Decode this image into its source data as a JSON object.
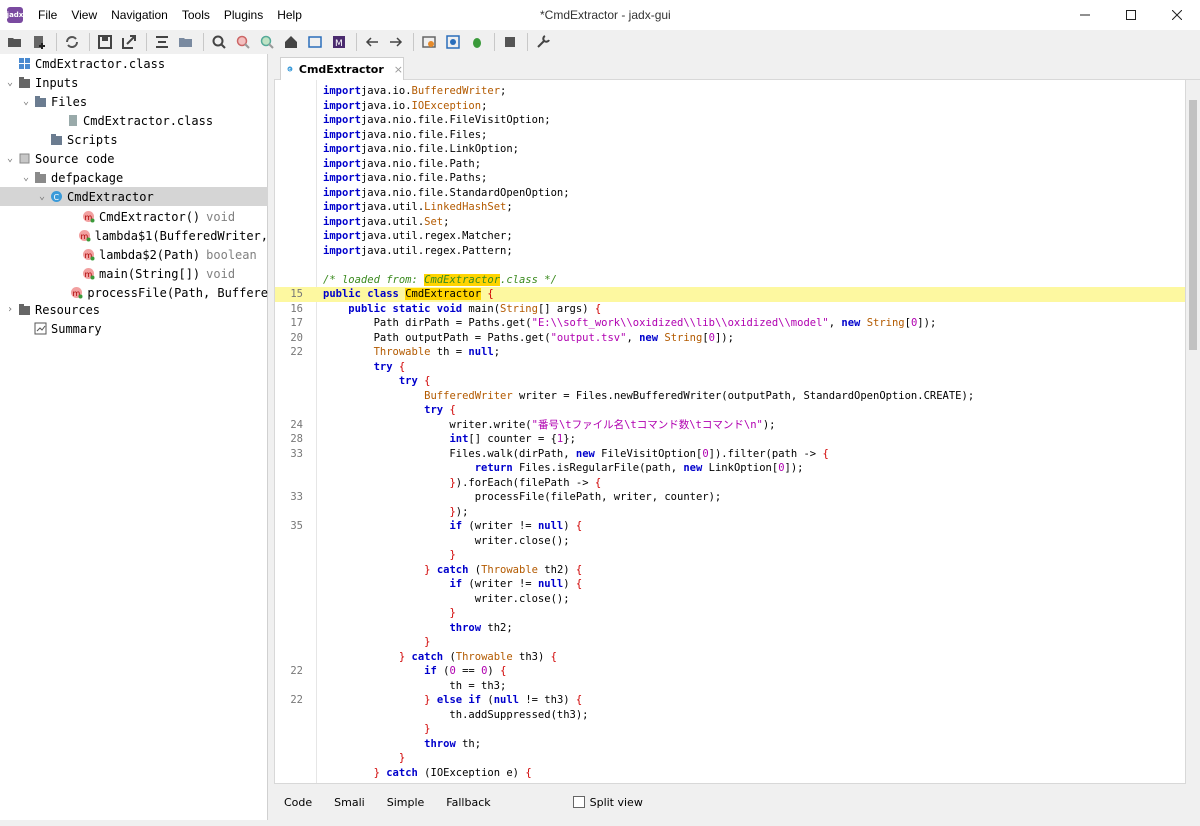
{
  "window": {
    "app_icon": "jadx",
    "title": "*CmdExtractor - jadx-gui",
    "controls": [
      "minimize-icon",
      "maximize-icon",
      "close-icon"
    ]
  },
  "menu": [
    "File",
    "View",
    "Navigation",
    "Tools",
    "Plugins",
    "Help"
  ],
  "toolbar": {
    "icons": [
      "open-folder-icon",
      "add-files-icon",
      "sync-icon",
      "save-icon",
      "export-icon",
      "sync-tree-icon",
      "flatten-packages-icon",
      "search-icon",
      "find-class-icon",
      "find-usage-icon",
      "home-icon",
      "logcat-icon",
      "smali-icon",
      "back-icon",
      "forward-icon",
      "deobfuscation-icon",
      "decompile-all-icon",
      "debug-icon",
      "log-icon",
      "preferences-icon"
    ]
  },
  "tree": {
    "items": [
      {
        "label": "CmdExtractor.class",
        "suffix": "",
        "icon": "jar-icon",
        "toggle": ""
      },
      {
        "label": "Inputs",
        "suffix": "",
        "icon": "inputs-folder-icon",
        "toggle": "v"
      },
      {
        "label": "Files",
        "suffix": "",
        "icon": "folder-icon",
        "toggle": "v"
      },
      {
        "label": "CmdExtractor.class",
        "suffix": "",
        "icon": "file-icon",
        "toggle": ""
      },
      {
        "label": "Scripts",
        "suffix": "",
        "icon": "folder-icon",
        "toggle": ""
      },
      {
        "label": "Source code",
        "suffix": "",
        "icon": "package-icon",
        "toggle": "v"
      },
      {
        "label": "defpackage",
        "suffix": "",
        "icon": "package-folder-icon",
        "toggle": "v"
      },
      {
        "label": "CmdExtractor",
        "suffix": "",
        "icon": "class-icon",
        "toggle": "v"
      },
      {
        "label": "CmdExtractor()",
        "suffix": "void",
        "icon": "method-icon",
        "toggle": ""
      },
      {
        "label": "lambda$1(BufferedWriter,",
        "suffix": "",
        "icon": "method-icon",
        "toggle": ""
      },
      {
        "label": "lambda$2(Path)",
        "suffix": "boolean",
        "icon": "method-icon",
        "toggle": ""
      },
      {
        "label": "main(String[])",
        "suffix": "void",
        "icon": "method-icon",
        "toggle": ""
      },
      {
        "label": "processFile(Path, Buffere",
        "suffix": "",
        "icon": "method-icon",
        "toggle": ""
      },
      {
        "label": "Resources",
        "suffix": "",
        "icon": "resources-icon",
        "toggle": ">"
      },
      {
        "label": "Summary",
        "suffix": "",
        "icon": "summary-icon",
        "toggle": ""
      }
    ]
  },
  "editor": {
    "tab_label": "CmdExtractor",
    "tab_close": "×",
    "lines": [
      {
        "n": "",
        "t": [
          [
            "kw",
            "import"
          ],
          [
            "",
            "java.io."
          ],
          [
            "ty",
            "BufferedWriter"
          ],
          [
            "",
            ";"
          ]
        ]
      },
      {
        "n": "",
        "t": [
          [
            "kw",
            "import"
          ],
          [
            "",
            "java.io."
          ],
          [
            "ty",
            "IOException"
          ],
          [
            "",
            ";"
          ]
        ]
      },
      {
        "n": "",
        "t": [
          [
            "kw",
            "import"
          ],
          [
            "",
            "java.nio.file.FileVisitOption;"
          ]
        ]
      },
      {
        "n": "",
        "t": [
          [
            "kw",
            "import"
          ],
          [
            "",
            "java.nio.file.Files;"
          ]
        ]
      },
      {
        "n": "",
        "t": [
          [
            "kw",
            "import"
          ],
          [
            "",
            "java.nio.file.LinkOption;"
          ]
        ]
      },
      {
        "n": "",
        "t": [
          [
            "kw",
            "import"
          ],
          [
            "",
            "java.nio.file.Path;"
          ]
        ]
      },
      {
        "n": "",
        "t": [
          [
            "kw",
            "import"
          ],
          [
            "",
            "java.nio.file.Paths;"
          ]
        ]
      },
      {
        "n": "",
        "t": [
          [
            "kw",
            "import"
          ],
          [
            "",
            "java.nio.file.StandardOpenOption;"
          ]
        ]
      },
      {
        "n": "",
        "t": [
          [
            "kw",
            "import"
          ],
          [
            "",
            "java.util."
          ],
          [
            "ty",
            "LinkedHashSet"
          ],
          [
            "",
            ";"
          ]
        ]
      },
      {
        "n": "",
        "t": [
          [
            "kw",
            "import"
          ],
          [
            "",
            "java.util."
          ],
          [
            "ty",
            "Set"
          ],
          [
            "",
            ";"
          ]
        ]
      },
      {
        "n": "",
        "t": [
          [
            "kw",
            "import"
          ],
          [
            "",
            "java.util.regex.Matcher;"
          ]
        ]
      },
      {
        "n": "",
        "t": [
          [
            "kw",
            "import"
          ],
          [
            "",
            "java.util.regex.Pattern;"
          ]
        ]
      },
      {
        "n": "",
        "t": []
      },
      {
        "n": "",
        "t": [
          [
            "cm",
            "/* loaded from: "
          ],
          [
            "cm-hl",
            "CmdExtractor"
          ],
          [
            "cm",
            ".class */"
          ]
        ]
      },
      {
        "n": "15",
        "hl": true,
        "t": [
          [
            "kw",
            "public class "
          ],
          [
            "cls-hl",
            "CmdExtractor"
          ],
          [
            "br",
            " {"
          ]
        ]
      },
      {
        "n": "16",
        "t": [
          [
            "",
            "    "
          ],
          [
            "kw",
            "public static void "
          ],
          [
            "",
            "main("
          ],
          [
            "ty",
            "String"
          ],
          [
            "",
            "[] args) "
          ],
          [
            "br",
            "{"
          ]
        ]
      },
      {
        "n": "17",
        "t": [
          [
            "",
            "        Path dirPath = Paths.get("
          ],
          [
            "str",
            "\"E:\\\\soft_work\\\\oxidized\\\\lib\\\\oxidized\\\\model\""
          ],
          [
            "",
            ", "
          ],
          [
            "kw",
            "new "
          ],
          [
            "ty",
            "String"
          ],
          [
            "",
            "["
          ],
          [
            "str",
            "0"
          ],
          [
            "",
            "]);"
          ]
        ]
      },
      {
        "n": "20",
        "t": [
          [
            "",
            "        Path outputPath = Paths.get("
          ],
          [
            "str",
            "\"output.tsv\""
          ],
          [
            "",
            ", "
          ],
          [
            "kw",
            "new "
          ],
          [
            "ty",
            "String"
          ],
          [
            "",
            "["
          ],
          [
            "str",
            "0"
          ],
          [
            "",
            "]);"
          ]
        ]
      },
      {
        "n": "22",
        "t": [
          [
            "",
            "        "
          ],
          [
            "ty",
            "Throwable"
          ],
          [
            "",
            " th = "
          ],
          [
            "kw",
            "null"
          ],
          [
            "",
            ";"
          ]
        ]
      },
      {
        "n": "",
        "t": [
          [
            "",
            "        "
          ],
          [
            "kw",
            "try "
          ],
          [
            "br",
            "{"
          ]
        ]
      },
      {
        "n": "",
        "t": [
          [
            "",
            "            "
          ],
          [
            "kw",
            "try "
          ],
          [
            "br",
            "{"
          ]
        ]
      },
      {
        "n": "",
        "t": [
          [
            "",
            "                "
          ],
          [
            "ty",
            "BufferedWriter"
          ],
          [
            "",
            " writer = Files.newBufferedWriter(outputPath, StandardOpenOption.CREATE);"
          ]
        ]
      },
      {
        "n": "",
        "t": [
          [
            "",
            "                "
          ],
          [
            "kw",
            "try "
          ],
          [
            "br",
            "{"
          ]
        ]
      },
      {
        "n": "24",
        "t": [
          [
            "",
            "                    writer.write("
          ],
          [
            "str",
            "\"番号\\tファイル名\\tコマンド数\\tコマンド\\n\""
          ],
          [
            "",
            ");"
          ]
        ]
      },
      {
        "n": "28",
        "t": [
          [
            "",
            "                    "
          ],
          [
            "kw",
            "int"
          ],
          [
            "",
            "[] counter = {"
          ],
          [
            "str",
            "1"
          ],
          [
            "",
            "};"
          ]
        ]
      },
      {
        "n": "33",
        "t": [
          [
            "",
            "                    Files.walk(dirPath, "
          ],
          [
            "kw",
            "new "
          ],
          [
            "",
            "FileVisitOption["
          ],
          [
            "str",
            "0"
          ],
          [
            "",
            "]).filter(path -> "
          ],
          [
            "br",
            "{"
          ]
        ]
      },
      {
        "n": "",
        "t": [
          [
            "",
            "                        "
          ],
          [
            "kw",
            "return "
          ],
          [
            "",
            "Files.isRegularFile(path, "
          ],
          [
            "kw",
            "new "
          ],
          [
            "",
            "LinkOption["
          ],
          [
            "str",
            "0"
          ],
          [
            "",
            "]);"
          ]
        ]
      },
      {
        "n": "",
        "t": [
          [
            "",
            "                    "
          ],
          [
            "br",
            "}"
          ],
          [
            "",
            ").forEach(filePath -> "
          ],
          [
            "br",
            "{"
          ]
        ]
      },
      {
        "n": "33",
        "t": [
          [
            "",
            "                        processFile(filePath, writer, counter);"
          ]
        ]
      },
      {
        "n": "",
        "t": [
          [
            "",
            "                    "
          ],
          [
            "br",
            "}"
          ],
          [
            "",
            ");"
          ]
        ]
      },
      {
        "n": "35",
        "t": [
          [
            "",
            "                    "
          ],
          [
            "kw",
            "if "
          ],
          [
            "",
            "(writer != "
          ],
          [
            "kw",
            "null"
          ],
          [
            "",
            ") "
          ],
          [
            "br",
            "{"
          ]
        ]
      },
      {
        "n": "",
        "t": [
          [
            "",
            "                        writer.close();"
          ]
        ]
      },
      {
        "n": "",
        "t": [
          [
            "",
            "                    "
          ],
          [
            "br",
            "}"
          ]
        ]
      },
      {
        "n": "",
        "t": [
          [
            "",
            "                "
          ],
          [
            "br",
            "}"
          ],
          [
            "",
            " "
          ],
          [
            "kw",
            "catch "
          ],
          [
            "",
            "("
          ],
          [
            "ty",
            "Throwable"
          ],
          [
            "",
            " th2) "
          ],
          [
            "br",
            "{"
          ]
        ]
      },
      {
        "n": "",
        "t": [
          [
            "",
            "                    "
          ],
          [
            "kw",
            "if "
          ],
          [
            "",
            "(writer != "
          ],
          [
            "kw",
            "null"
          ],
          [
            "",
            ") "
          ],
          [
            "br",
            "{"
          ]
        ]
      },
      {
        "n": "",
        "t": [
          [
            "",
            "                        writer.close();"
          ]
        ]
      },
      {
        "n": "",
        "t": [
          [
            "",
            "                    "
          ],
          [
            "br",
            "}"
          ]
        ]
      },
      {
        "n": "",
        "t": [
          [
            "",
            "                    "
          ],
          [
            "kw",
            "throw "
          ],
          [
            "",
            "th2;"
          ]
        ]
      },
      {
        "n": "",
        "t": [
          [
            "",
            "                "
          ],
          [
            "br",
            "}"
          ]
        ]
      },
      {
        "n": "",
        "t": [
          [
            "",
            "            "
          ],
          [
            "br",
            "}"
          ],
          [
            "",
            " "
          ],
          [
            "kw",
            "catch "
          ],
          [
            "",
            "("
          ],
          [
            "ty",
            "Throwable"
          ],
          [
            "",
            " th3) "
          ],
          [
            "br",
            "{"
          ]
        ]
      },
      {
        "n": "22",
        "t": [
          [
            "",
            "                "
          ],
          [
            "kw",
            "if "
          ],
          [
            "",
            "("
          ],
          [
            "str",
            "0"
          ],
          [
            "",
            " == "
          ],
          [
            "str",
            "0"
          ],
          [
            "",
            ") "
          ],
          [
            "br",
            "{"
          ]
        ]
      },
      {
        "n": "",
        "t": [
          [
            "",
            "                    th = th3;"
          ]
        ]
      },
      {
        "n": "22",
        "t": [
          [
            "",
            "                "
          ],
          [
            "br",
            "}"
          ],
          [
            "",
            " "
          ],
          [
            "kw",
            "else if "
          ],
          [
            "",
            "("
          ],
          [
            "kw",
            "null"
          ],
          [
            "",
            " != th3) "
          ],
          [
            "br",
            "{"
          ]
        ]
      },
      {
        "n": "",
        "t": [
          [
            "",
            "                    th.addSuppressed(th3);"
          ]
        ]
      },
      {
        "n": "",
        "t": [
          [
            "",
            "                "
          ],
          [
            "br",
            "}"
          ]
        ]
      },
      {
        "n": "",
        "t": [
          [
            "",
            "                "
          ],
          [
            "kw",
            "throw "
          ],
          [
            "",
            "th;"
          ]
        ]
      },
      {
        "n": "",
        "t": [
          [
            "",
            "            "
          ],
          [
            "br",
            "}"
          ]
        ]
      },
      {
        "n": "",
        "t": [
          [
            "",
            "        "
          ],
          [
            "br",
            "}"
          ],
          [
            "",
            " "
          ],
          [
            "kw",
            "catch "
          ],
          [
            "",
            "(IOException e) "
          ],
          [
            "br",
            "{"
          ]
        ]
      }
    ]
  },
  "bottom_tabs": [
    "Code",
    "Smali",
    "Simple",
    "Fallback"
  ],
  "split_view_label": "Split view"
}
